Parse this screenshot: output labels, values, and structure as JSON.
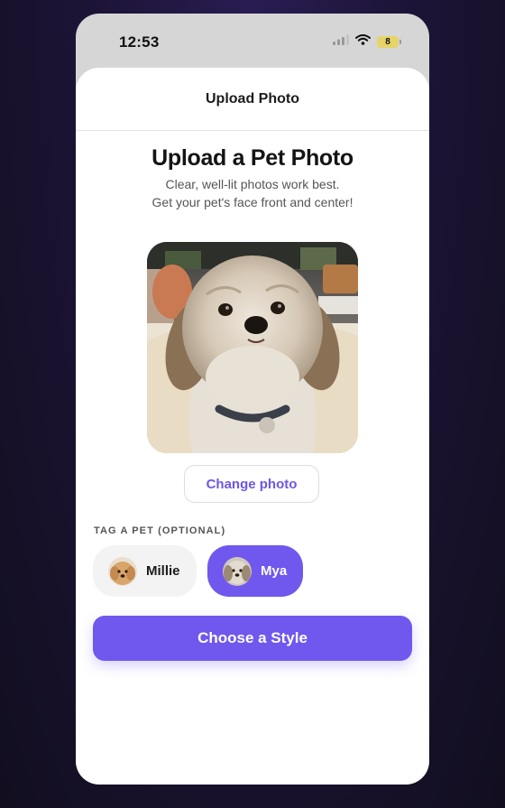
{
  "status_bar": {
    "time": "12:53",
    "battery": "8",
    "icons": [
      "signal-icon",
      "wifi-icon",
      "battery-icon"
    ]
  },
  "header": {
    "title": "Upload Photo"
  },
  "main": {
    "heading": "Upload a Pet Photo",
    "subtitle_line1": "Clear, well-lit photos work best.",
    "subtitle_line2": "Get your pet's face front and center!",
    "photo_icon": "dog-photo",
    "change_photo_label": "Change photo"
  },
  "tag_section": {
    "label": "TAG A PET (OPTIONAL)",
    "pets": [
      {
        "name": "Millie",
        "selected": false
      },
      {
        "name": "Mya",
        "selected": true
      }
    ]
  },
  "cta": {
    "label": "Choose a Style"
  },
  "colors": {
    "accent": "#7057ee",
    "accent_text": "#6f55e8",
    "background": "#1c1436",
    "chip_unselected": "#f3f3f3",
    "battery": "#e6d36a"
  }
}
